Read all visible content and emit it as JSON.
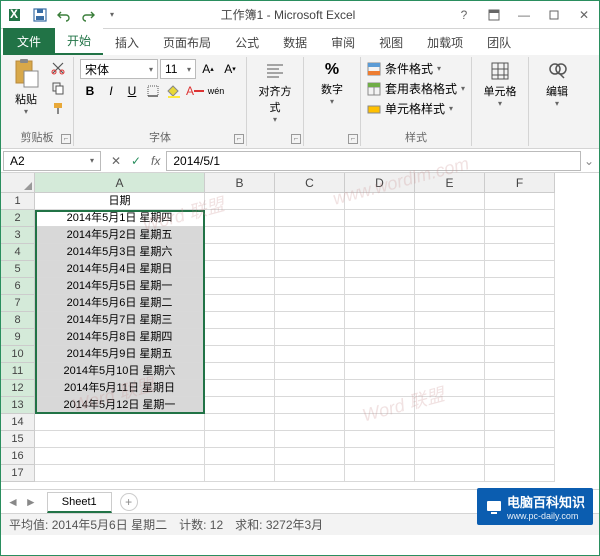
{
  "window": {
    "title": "工作簿1 - Microsoft Excel"
  },
  "qat": {
    "save": "save-icon",
    "undo": "undo-icon",
    "redo": "redo-icon"
  },
  "tabs": {
    "file": "文件",
    "home": "开始",
    "insert": "插入",
    "pagelayout": "页面布局",
    "formulas": "公式",
    "data": "数据",
    "review": "审阅",
    "view": "视图",
    "addins": "加载项",
    "team": "团队"
  },
  "ribbon": {
    "clipboard": {
      "label": "剪贴板",
      "paste": "粘贴"
    },
    "font": {
      "label": "字体",
      "name": "宋体",
      "size": "11",
      "bold": "B",
      "italic": "I",
      "underline": "U",
      "wen": "wén"
    },
    "alignment": {
      "label": "对齐方式"
    },
    "number": {
      "label": "数字",
      "percent": "%"
    },
    "styles": {
      "label": "样式",
      "cond": "条件格式",
      "table": "套用表格格式",
      "cell": "单元格样式"
    },
    "cells": {
      "label": "单元格"
    },
    "editing": {
      "label": "编辑"
    }
  },
  "namebox": "A2",
  "formula": "2014/5/1",
  "columns": [
    "A",
    "B",
    "C",
    "D",
    "E",
    "F"
  ],
  "header_cell": "日期",
  "data_rows": [
    "2014年5月1日  星期四",
    "2014年5月2日  星期五",
    "2014年5月3日  星期六",
    "2014年5月4日  星期日",
    "2014年5月5日  星期一",
    "2014年5月6日  星期二",
    "2014年5月7日  星期三",
    "2014年5月8日  星期四",
    "2014年5月9日  星期五",
    "2014年5月10日 星期六",
    "2014年5月11日 星期日",
    "2014年5月12日 星期一"
  ],
  "sheet": {
    "name": "Sheet1"
  },
  "status": {
    "avg_label": "平均值:",
    "avg": "2014年5月6日 星期二",
    "count_label": "计数:",
    "count": "12",
    "sum_label": "求和:",
    "sum": "3272年3月"
  },
  "badge": {
    "main": "电脑百科知识",
    "sub": "www.pc-daily.com"
  }
}
